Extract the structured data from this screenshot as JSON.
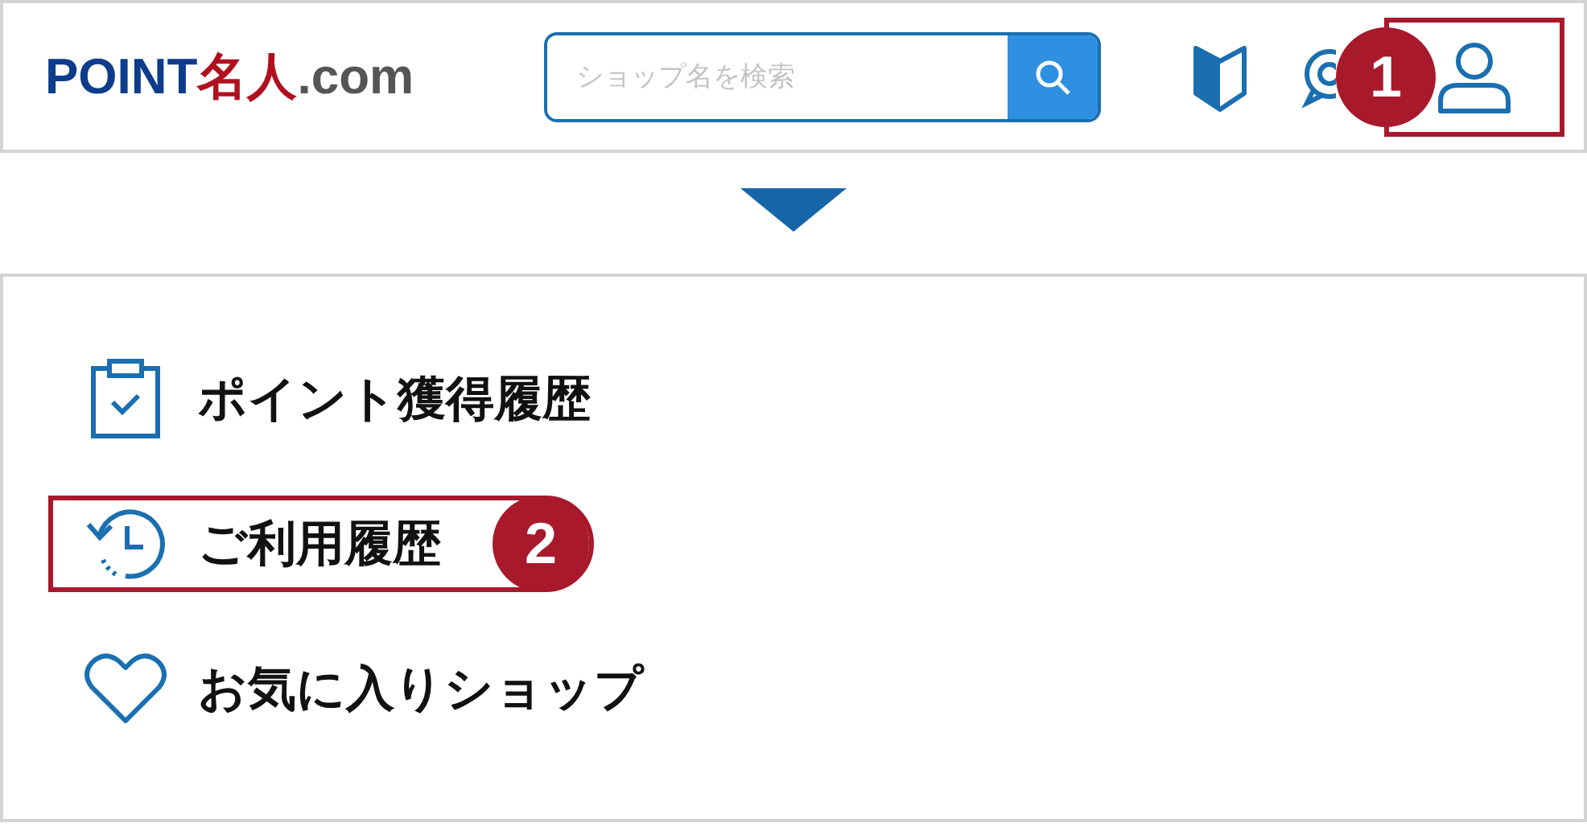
{
  "header": {
    "logo": [
      {
        "text": "POINT",
        "color": "#0d3c8c"
      },
      {
        "text": "名人",
        "color": "#b0101e"
      },
      {
        "text": ".com",
        "color": "#555555"
      }
    ],
    "search": {
      "placeholder": "ショップ名を検索"
    },
    "icons": [
      {
        "kind": "beginner",
        "highlighted": false
      },
      {
        "kind": "chat",
        "highlighted": false
      },
      {
        "kind": "user",
        "highlighted": true,
        "callout": "1"
      }
    ]
  },
  "menu": {
    "items": [
      {
        "kind": "clipboard",
        "label": "ポイント獲得履歴",
        "highlighted": false
      },
      {
        "kind": "history",
        "label": "ご利用履歴",
        "highlighted": true,
        "callout": "2"
      },
      {
        "kind": "heart",
        "label": "お気に入りショップ",
        "highlighted": false
      }
    ]
  }
}
